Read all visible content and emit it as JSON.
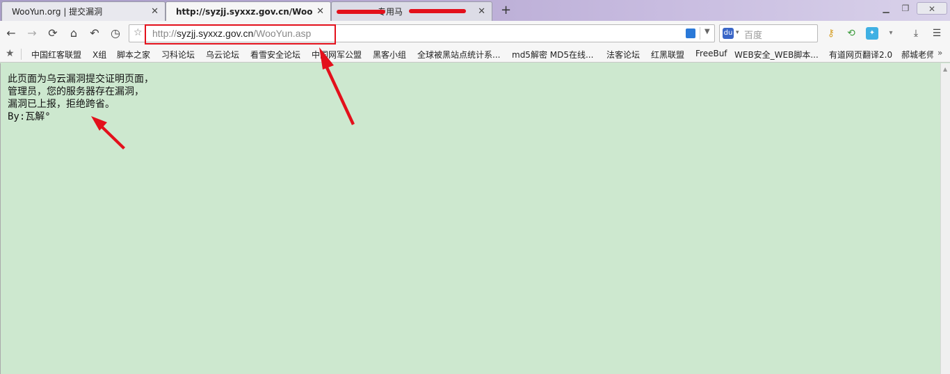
{
  "tabs": [
    {
      "title": "WooYun.org | 提交漏洞",
      "close": "✕"
    },
    {
      "title": "http://syzjj.syxxz.gov.cn/WooYun....",
      "close": "✕"
    },
    {
      "title": "专用马",
      "close": "✕"
    }
  ],
  "new_tab": "+",
  "window_controls": {
    "minimize": "▁",
    "maximize": "❐",
    "close": "✕"
  },
  "nav": {
    "back": "←",
    "forward": "→",
    "reload": "⟳",
    "home": "⌂",
    "undo": "↶",
    "history": "◷"
  },
  "address": {
    "star": "☆",
    "url_prefix": "http://",
    "url_host": "syzjj.syxxz.gov.cn",
    "url_path": "/WooYun.asp",
    "dropdown": "▼"
  },
  "search": {
    "placeholder": "百度",
    "engine_icon": "paw-icon",
    "dropdown": "▾"
  },
  "toolbar_icons": [
    "key-icon",
    "refresh-person-icon",
    "game-icon",
    "download-icon",
    "menu-icon"
  ],
  "bookmarks": [
    "中国红客联盟",
    "X组",
    "脚本之家",
    "习科论坛",
    "乌云论坛",
    "看雪安全论坛",
    "中国网军公盟",
    "黑客小组",
    "全球被黑站点统计系...",
    "md5解密 MD5在线...",
    "法客论坛",
    "红黑联盟",
    "FreeBuf",
    "WEB安全_WEB脚本...",
    "有道网页翻译2.0",
    "郝城老师"
  ],
  "bookmarks_more": "»",
  "page": {
    "lines": [
      "此页面为乌云漏洞提交证明页面，",
      "管理员，您的服务器存在漏洞，",
      "漏洞已上报，拒绝跨省。",
      "By:瓦解°"
    ]
  },
  "colors": {
    "content_bg": "#cde8cf",
    "annotation_red": "#e3101b",
    "tabstrip_purple": "#b6a8d2"
  }
}
